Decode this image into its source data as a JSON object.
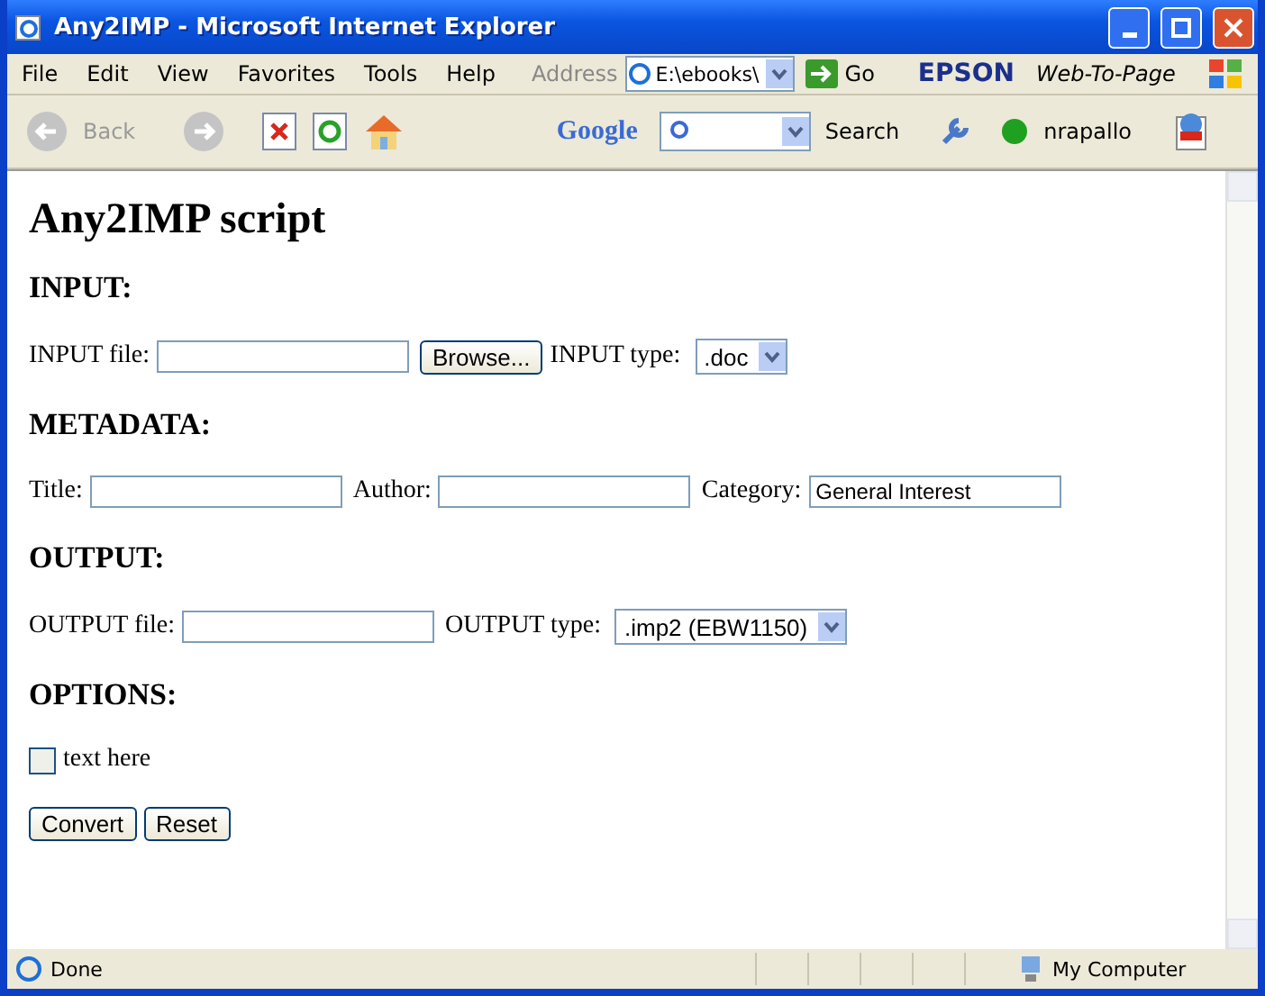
{
  "window": {
    "title": "Any2IMP - Microsoft Internet Explorer"
  },
  "menu": [
    "File",
    "Edit",
    "View",
    "Favorites",
    "Tools",
    "Help"
  ],
  "address": {
    "label": "Address",
    "value": "E:\\ebooks\\",
    "go": "Go"
  },
  "epson": {
    "brand": "EPSON",
    "label": "Web-To-Page"
  },
  "toolbar": {
    "back": "Back",
    "google": "Google",
    "search": "Search",
    "user": "nrapallo"
  },
  "page": {
    "heading": "Any2IMP script",
    "sections": [
      {
        "title": "INPUT:",
        "fields": [
          {
            "kind": "file",
            "label": "INPUT file:",
            "button": "Browse..."
          },
          {
            "kind": "select",
            "label": "INPUT type:",
            "value": ".doc"
          }
        ]
      },
      {
        "title": "METADATA:",
        "fields": [
          {
            "kind": "text",
            "label": "Title:"
          },
          {
            "kind": "text",
            "label": "Author:"
          },
          {
            "kind": "text",
            "label": "Category:",
            "value": "General Interest"
          }
        ]
      },
      {
        "title": "OUTPUT:",
        "fields": [
          {
            "kind": "text",
            "label": "OUTPUT file:"
          },
          {
            "kind": "select",
            "label": "OUTPUT type:",
            "value": ".imp2 (EBW1150)"
          }
        ]
      },
      {
        "title": "OPTIONS:",
        "fields": [
          {
            "kind": "checkbox",
            "label": "text here",
            "checked": false
          }
        ]
      }
    ],
    "buttons": [
      "Convert",
      "Reset"
    ]
  },
  "status": {
    "text": "Done",
    "zone": "My Computer"
  }
}
